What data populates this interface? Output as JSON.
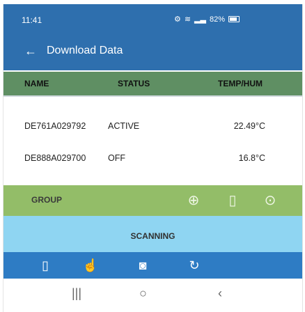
{
  "status_bar": {
    "time": "11:41",
    "battery": "82%"
  },
  "header": {
    "title": "Download Data"
  },
  "table": {
    "columns": [
      "NAME",
      "STATUS",
      "TEMP/HUM"
    ],
    "rows": [
      {
        "name": "DE761A029792",
        "status": "ACTIVE",
        "temp": "22.49°C"
      },
      {
        "name": "DE888A029700",
        "status": "OFF",
        "temp": "16.8°C"
      }
    ]
  },
  "group": {
    "label": "GROUP"
  },
  "scan": {
    "status": "SCANNING"
  },
  "colors": {
    "appbar": "#2e6fae",
    "header_row": "#5f8f63",
    "group_bar": "#93bd68",
    "scan_band": "#8fd5f2",
    "toolbar": "#2e7cc4"
  },
  "icons": {
    "group_actions": [
      "add-circle-icon",
      "device-icon",
      "download-circle-icon"
    ],
    "toolbar": [
      "phone-outline-icon",
      "touch-icon",
      "camera-icon",
      "rotate-icon"
    ],
    "nav": [
      "recent-apps-icon",
      "home-icon",
      "back-nav-icon"
    ]
  }
}
